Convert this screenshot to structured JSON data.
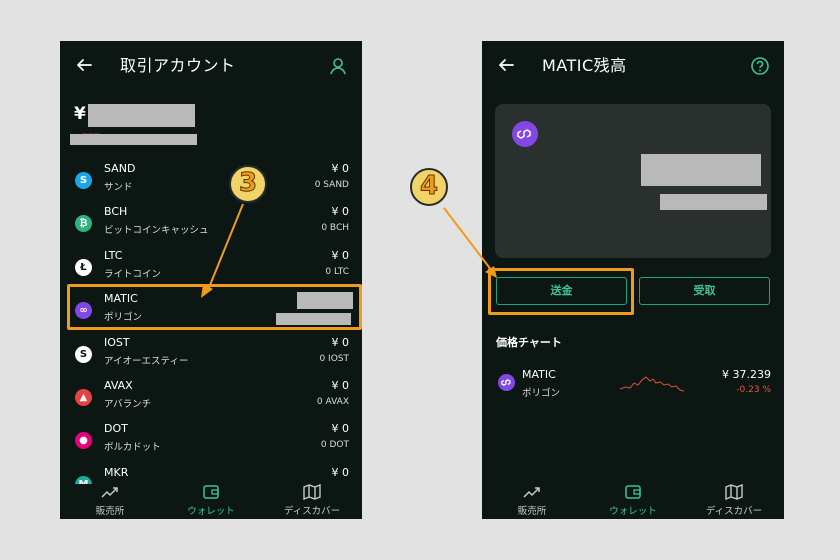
{
  "left_screen": {
    "title": "取引アカウント",
    "balance_currency": "¥",
    "balance_red_text": "ーーー",
    "assets": [
      {
        "symbol": "SAND",
        "name_jp": "サンド",
        "amount": "¥ 0",
        "quantity": "0 SAND",
        "color": "#1ba7e0",
        "glyph": "S",
        "icon": "sand-coin-icon"
      },
      {
        "symbol": "BCH",
        "name_jp": "ビットコインキャッシュ",
        "amount": "¥ 0",
        "quantity": "0 BCH",
        "color": "#2fb37e",
        "glyph": "₿",
        "icon": "bch-coin-icon"
      },
      {
        "symbol": "LTC",
        "name_jp": "ライトコイン",
        "amount": "¥ 0",
        "quantity": "0 LTC",
        "color": "#ffffff",
        "glyph": "Ł",
        "icon": "ltc-coin-icon"
      },
      {
        "symbol": "MATIC",
        "name_jp": "ポリゴン",
        "amount": "",
        "quantity": "",
        "color": "#8247e5",
        "glyph": "∞",
        "icon": "matic-coin-icon"
      },
      {
        "symbol": "IOST",
        "name_jp": "アイオーエスティー",
        "amount": "¥ 0",
        "quantity": "0 IOST",
        "color": "#ffffff",
        "glyph": "S",
        "icon": "iost-coin-icon"
      },
      {
        "symbol": "AVAX",
        "name_jp": "アバランチ",
        "amount": "¥ 0",
        "quantity": "0 AVAX",
        "color": "#e84142",
        "glyph": "▲",
        "icon": "avax-coin-icon"
      },
      {
        "symbol": "DOT",
        "name_jp": "ボルカドット",
        "amount": "¥ 0",
        "quantity": "0 DOT",
        "color": "#e6007a",
        "glyph": "●",
        "icon": "dot-coin-icon"
      },
      {
        "symbol": "MKR",
        "name_jp": "",
        "amount": "¥ 0",
        "quantity": "",
        "color": "#1aab9b",
        "glyph": "M",
        "icon": "mkr-coin-icon"
      }
    ],
    "step_label": "3"
  },
  "right_screen": {
    "title": "MATIC残高",
    "send_label": "送金",
    "receive_label": "受取",
    "chart_section_title": "価格チャート",
    "coin_symbol": "MATIC",
    "coin_name_jp": "ポリゴン",
    "price": "¥ 37.239",
    "change": "-0.23 %",
    "step_label": "4"
  },
  "tabs": [
    {
      "label": "販売所",
      "icon": "trend-icon"
    },
    {
      "label": "ウォレット",
      "icon": "wallet-icon"
    },
    {
      "label": "ディスカバー",
      "icon": "map-icon"
    }
  ],
  "active_tab_index": 1,
  "colors": {
    "background": "#e3e2e2",
    "phone_bg": "#0c1714",
    "accent_green": "#3ec19a",
    "highlight_orange": "#f29a1b",
    "negative_red": "#e0533b"
  }
}
